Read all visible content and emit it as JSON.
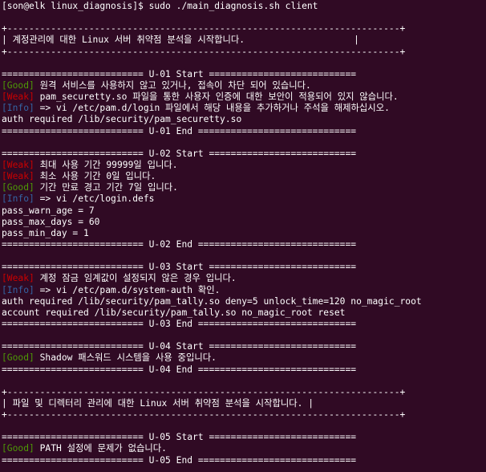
{
  "colors": {
    "background": "#300a24",
    "text": "#ffffff",
    "good": "#4e9a06",
    "weak": "#cc0000",
    "info": "#3465a4"
  },
  "terminal": {
    "lines": [
      {
        "text": "[son@elk linux_diagnosis]$ sudo ./main_diagnosis.sh client"
      },
      {
        "text": ""
      },
      {
        "text": "+------------------------------------------------------------------------+"
      },
      {
        "text": "| 계정관리에 대한 Linux 서버 취약점 분석을 시작합니다.                    |"
      },
      {
        "text": "+------------------------------------------------------------------------+"
      },
      {
        "text": ""
      },
      {
        "text": "========================== U-01 Start ==========================="
      },
      {
        "tag": "[Good]",
        "level": "good",
        "text": " 원격 서비스를 사용하지 않고 있거나, 접속이 차단 되어 있습니다."
      },
      {
        "tag": "[Weak]",
        "level": "weak",
        "text": " pam_securetty.so 파일을 통한 사용자 인증에 대한 보안이 적용되어 있지 않습니다."
      },
      {
        "tag": "[Info]",
        "level": "info",
        "text": " => vi /etc/pam.d/login 파일에서 해당 내용을 추가하거나 주석을 해제하십시오."
      },
      {
        "text": "auth required /lib/security/pam_securetty.so"
      },
      {
        "text": "========================== U-01 End ============================="
      },
      {
        "text": ""
      },
      {
        "text": "========================== U-02 Start ==========================="
      },
      {
        "tag": "[Weak]",
        "level": "weak",
        "text": " 최대 사용 기간 99999일 입니다."
      },
      {
        "tag": "[Weak]",
        "level": "weak",
        "text": " 최소 사용 기간 0일 입니다."
      },
      {
        "tag": "[Good]",
        "level": "good",
        "text": " 기간 만료 경고 기간 7일 입니다."
      },
      {
        "tag": "[Info]",
        "level": "info",
        "text": " => vi /etc/login.defs"
      },
      {
        "text": "pass_warn_age = 7"
      },
      {
        "text": "pass_max_days = 60"
      },
      {
        "text": "pass_min_day = 1"
      },
      {
        "text": "========================== U-02 End ============================="
      },
      {
        "text": ""
      },
      {
        "text": "========================== U-03 Start ==========================="
      },
      {
        "tag": "[Weak]",
        "level": "weak",
        "text": " 계정 잠금 임계값이 설정되지 않은 경우 입니다."
      },
      {
        "tag": "[Info]",
        "level": "info",
        "text": " => vi /etc/pam.d/system-auth 확인."
      },
      {
        "text": "auth required /lib/security/pam_tally.so deny=5 unlock_time=120 no_magic_root"
      },
      {
        "text": "account required /lib/security/pam_tally.so no_magic_root reset"
      },
      {
        "text": "========================== U-03 End ============================="
      },
      {
        "text": ""
      },
      {
        "text": "========================== U-04 Start ==========================="
      },
      {
        "tag": "[Good]",
        "level": "good",
        "text": " Shadow 패스워드 시스템을 사용 중입니다."
      },
      {
        "text": "========================== U-04 End ============================="
      },
      {
        "text": ""
      },
      {
        "text": "+------------------------------------------------------------------------+"
      },
      {
        "text": "| 파일 및 디렉터리 관리에 대한 Linux 서버 취약점 분석을 시작합니다. |"
      },
      {
        "text": "+------------------------------------------------------------------------+"
      },
      {
        "text": ""
      },
      {
        "text": "========================== U-05 Start ==========================="
      },
      {
        "tag": "[Good]",
        "level": "good",
        "text": " PATH 설정에 문제가 없습니다."
      },
      {
        "text": "========================== U-05 End ============================="
      }
    ]
  }
}
